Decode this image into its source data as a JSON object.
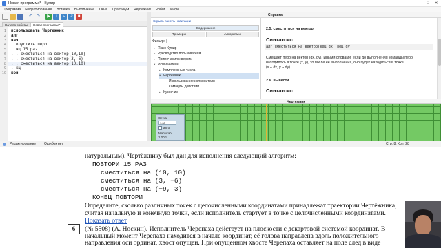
{
  "window": {
    "title": "Новая программа* - Кумир",
    "controls": [
      "minimize-icon",
      "maximize-icon",
      "close-icon"
    ]
  },
  "menu": [
    "Программа",
    "Редактирование",
    "Вставка",
    "Выполнение",
    "Окна",
    "Практикум",
    "Чертежник",
    "Робот",
    "Инфо"
  ],
  "toolbar_icons": [
    "new-file-icon",
    "open-file-icon",
    "save-icon",
    "undo-icon",
    "redo-icon",
    "run-icon",
    "step-icon",
    "step-in-icon",
    "step-out-icon",
    "stop-icon"
  ],
  "tabs": [
    "Начало работы",
    "Новая программа*"
  ],
  "editor": {
    "line_numbers": [
      "1",
      "2",
      "3",
      "4",
      "5",
      "6",
      "7",
      "8",
      "9",
      "10"
    ],
    "lines": [
      "использовать Чертежник",
      "алг",
      "нач",
      ". опустить перо",
      ". нц 15 раз",
      ". . сместиться на вектор(10,10)",
      ". . сместиться на вектор(3,-6)",
      ". . сместиться на вектор(10,10)",
      ". кц",
      "кон"
    ]
  },
  "help": {
    "header": "Справка",
    "hide_nav_link": "Скрыть панель навигации",
    "tab_contents": "Содержание",
    "tab_examples": "Примеры",
    "tab_algorithms": "Алгоритмы",
    "filter_label": "Фильтр:",
    "filter_value": "",
    "tree": [
      "Язык Кумир",
      "Руководство пользователя",
      "Примечания к версии",
      "Исполнители",
      "Комплексные числа",
      "Чертежник",
      "Использование исполнителя",
      "Команды действий",
      "Кузнечик"
    ],
    "section_title": "2.5. сместиться на вектор",
    "syntax_label": "Синтаксис:",
    "syntax_code": "алг сместиться на вектор(вещ dx, вещ dy)",
    "description": [
      "Смещает перо на вектор (dx, dy). Иными словами, если до выполнения команды перо",
      "находилось в точке (x, y), то после её выполнения, оно будет находиться в точке",
      "(x + dx, y + dy)."
    ],
    "next_section_title": "2.6. вывести",
    "next_syntax_label": "Синтаксис:"
  },
  "drawer": {
    "title": "Чертежник",
    "grid_label": "Сетка",
    "grid_value": "1.00",
    "auto_label": "авто",
    "scale_label": "Масштаб:",
    "scale_value": "1.00:1"
  },
  "status": {
    "mode": "Редактирование",
    "errors": "Ошибок нет",
    "cursor": "Стр: 8, Кол: 28"
  },
  "document": {
    "intro": "натуральным). Чертёжнику был дан для исполнения следующий алгоритм:",
    "algorithm": [
      "ПОВТОРИ 15 РАЗ",
      "сместиться на (10, 10)",
      "сместиться на (3, −6)",
      "сместиться на (−9, 3)",
      "КОНЕЦ ПОВТОРИ"
    ],
    "question": [
      "Определите, сколько различных точек с целочисленными координатами принадлежат траектории Чертёжника,",
      "считая начальную и конечную точки, если исполнитель стартует в точке с целочисленными координатами."
    ],
    "answer_link": "Показать ответ",
    "task_number": "6",
    "task_lines": [
      "(№ 5508) (А. Носкин). Исполнитель Черепаха действует на плоскости с декартовой системой координат. В",
      "начальный момент Черепаха находится в начале координат, её голова направлена вдоль положительного",
      "направления оси ординат, хвост опущен. При опущенном хвосте Черепаха оставляет на поле след в виде"
    ]
  },
  "colors": {
    "grid_green": "#74c964",
    "grid_line": "#3f8f35",
    "axis": "#e2b233",
    "link": "#1a4fb5",
    "selection": "#cfe0f3"
  }
}
